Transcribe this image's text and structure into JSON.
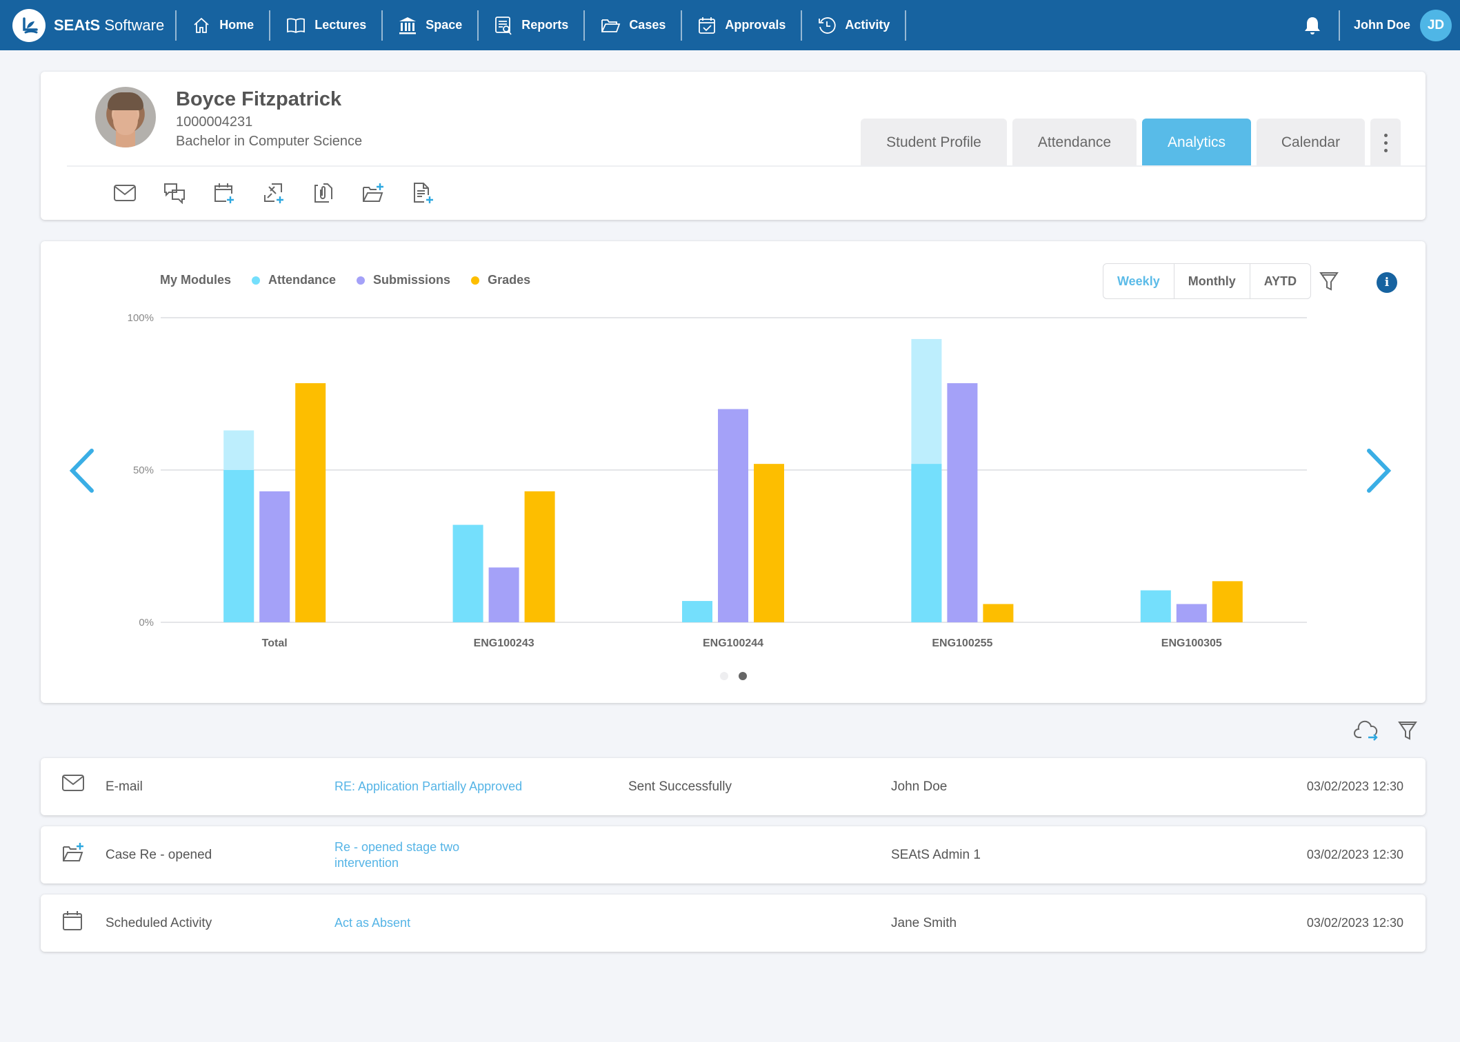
{
  "app": {
    "brand_bold": "SEAtS",
    "brand_light": " Software",
    "nav": [
      {
        "label": "Home",
        "icon": "home-icon"
      },
      {
        "label": "Lectures",
        "icon": "book-icon"
      },
      {
        "label": "Space",
        "icon": "building-icon"
      },
      {
        "label": "Reports",
        "icon": "report-icon"
      },
      {
        "label": "Cases",
        "icon": "folder-icon"
      },
      {
        "label": "Approvals",
        "icon": "calendar-check-icon"
      },
      {
        "label": "Activity",
        "icon": "history-icon"
      }
    ],
    "user": {
      "name": "John Doe",
      "initials": "JD"
    }
  },
  "student": {
    "name": "Boyce Fitzpatrick",
    "id": "1000004231",
    "course": "Bachelor in Computer Science"
  },
  "tabs": [
    {
      "label": "Student Profile",
      "active": false
    },
    {
      "label": "Attendance",
      "active": false
    },
    {
      "label": "Analytics",
      "active": true
    },
    {
      "label": "Calendar",
      "active": false
    }
  ],
  "actions": [
    "mail-icon",
    "chat-icon",
    "calendar-add-icon",
    "pin-add-icon",
    "attachment-icon",
    "folder-add-icon",
    "document-add-icon"
  ],
  "chart_controls": {
    "legend_title": "My Modules",
    "periods": [
      {
        "label": "Weekly",
        "active": true
      },
      {
        "label": "Monthly",
        "active": false
      },
      {
        "label": "AYTD",
        "active": false
      }
    ],
    "info_label": "i",
    "pages": 2,
    "current_page": 2
  },
  "colors": {
    "primary": "#1763a0",
    "accent": "#58bbe8",
    "attendance": "#74dffc",
    "attendance_light": "#bdeefd",
    "submissions": "#a4a1f8",
    "grades": "#fdbe00",
    "link": "#55b4e6"
  },
  "chart_data": {
    "type": "bar",
    "title": "",
    "xlabel": "",
    "ylabel": "",
    "ylim": [
      0,
      100
    ],
    "yticks": [
      "0%",
      "50%",
      "100%"
    ],
    "ytick_values": [
      0,
      50,
      100
    ],
    "grid": true,
    "legend": "top-left",
    "categories": [
      "Total",
      "ENG100243",
      "ENG100244",
      "ENG100255",
      "ENG100305"
    ],
    "series": [
      {
        "name": "Attendance",
        "values": [
          50,
          32,
          7,
          52,
          10.5
        ],
        "extended_values": [
          63,
          null,
          null,
          93,
          null
        ]
      },
      {
        "name": "Submissions",
        "values": [
          43,
          18,
          70,
          78.5,
          6
        ]
      },
      {
        "name": "Grades",
        "values": [
          78.5,
          43,
          52,
          6,
          13.5
        ]
      }
    ]
  },
  "activity": [
    {
      "icon": "mail-icon",
      "type": "E-mail",
      "link": "RE: Application Partially Approved",
      "status": "Sent Successfully",
      "user": "John Doe",
      "date": "03/02/2023 12:30"
    },
    {
      "icon": "folder-add-icon",
      "type": "Case Re - opened",
      "link": "Re - opened stage two intervention",
      "status": "",
      "user": "SEAtS Admin 1",
      "date": "03/02/2023 12:30"
    },
    {
      "icon": "calendar-icon",
      "type": "Scheduled Activity",
      "link": "Act as Absent",
      "status": "",
      "user": "Jane Smith",
      "date": "03/02/2023 12:30"
    }
  ]
}
